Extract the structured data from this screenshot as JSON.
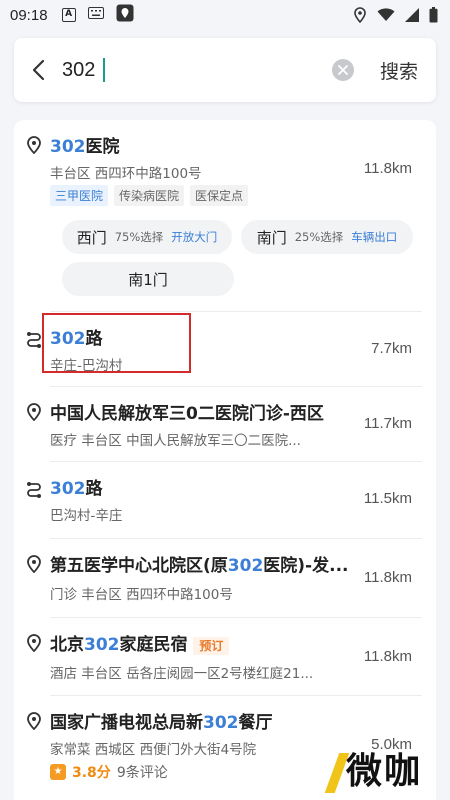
{
  "status_bar": {
    "time": "09:18"
  },
  "search": {
    "value": "302",
    "button_label": "搜索"
  },
  "results": [
    {
      "title_hl": "302",
      "title_rest": "医院",
      "subtitle": "丰台区 西四环中路100号",
      "distance": "11.8km",
      "tags": [
        "三甲医院",
        "传染病医院",
        "医保定点"
      ],
      "gates": [
        {
          "name": "西门",
          "pct": "75%选择",
          "action": "开放大门"
        },
        {
          "name": "南门",
          "pct": "25%选择",
          "action": "车辆出口"
        },
        {
          "name": "南1门"
        }
      ]
    },
    {
      "title_hl": "302",
      "title_rest": "路",
      "subtitle": "辛庄-巴沟村",
      "distance": "7.7km"
    },
    {
      "title": "中国人民解放军三0二医院门诊-西区",
      "subtitle": "医疗  丰台区 中国人民解放军三〇二医院...",
      "distance": "11.7km"
    },
    {
      "title_hl": "302",
      "title_rest": "路",
      "subtitle": "巴沟村-辛庄",
      "distance": "11.5km"
    },
    {
      "title_pre": "第五医学中心北院区(原",
      "title_hl": "302",
      "title_rest": "医院)-发...",
      "subtitle": "门诊  丰台区 西四环中路100号",
      "distance": "11.8km"
    },
    {
      "title_pre": "北京",
      "title_hl": "302",
      "title_rest": "家庭民宿",
      "tag": "预订",
      "subtitle": "酒店  丰台区 岳各庄阅园一区2号楼红庭21...",
      "distance": "11.8km"
    },
    {
      "title_pre": "国家广播电视总局新",
      "title_hl": "302",
      "title_rest": "餐厅",
      "subtitle": "家常菜  西城区 西便门外大街4号院",
      "distance": "5.0km",
      "rating": "3.8分",
      "reviews": "9条评论"
    }
  ],
  "watermark": "微咖",
  "colors": {
    "highlight": "#3b7fd6",
    "annotation_box": "#d32a2a",
    "rating": "#f08a12"
  }
}
